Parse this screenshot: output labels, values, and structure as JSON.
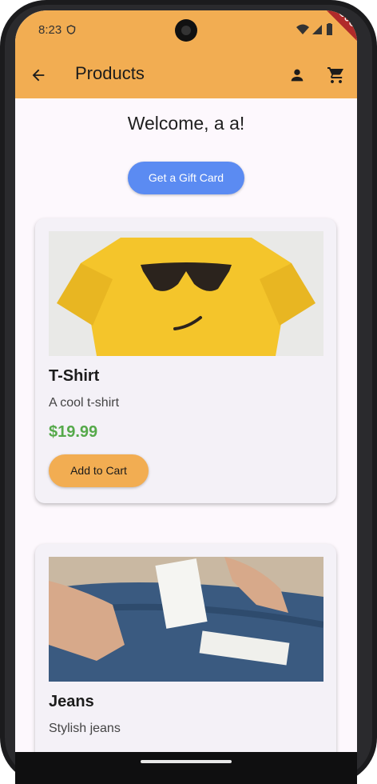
{
  "status": {
    "time": "8:23",
    "debug_label": "DEBUG"
  },
  "appbar": {
    "title": "Products"
  },
  "welcome": "Welcome, a a!",
  "gift_button": "Get a Gift Card",
  "products": [
    {
      "name": "T-Shirt",
      "description": "A cool t-shirt",
      "price": "$19.99",
      "button": "Add to Cart"
    },
    {
      "name": "Jeans",
      "description": "Stylish jeans",
      "price": "",
      "button": ""
    }
  ],
  "colors": {
    "appbar": "#f2ad52",
    "gift": "#5b8bf2",
    "price": "#55a94a",
    "background": "#fdf8fd"
  },
  "icons": [
    "shield-icon",
    "wifi-icon",
    "signal-icon",
    "battery-icon",
    "back-arrow-icon",
    "person-icon",
    "cart-icon"
  ]
}
